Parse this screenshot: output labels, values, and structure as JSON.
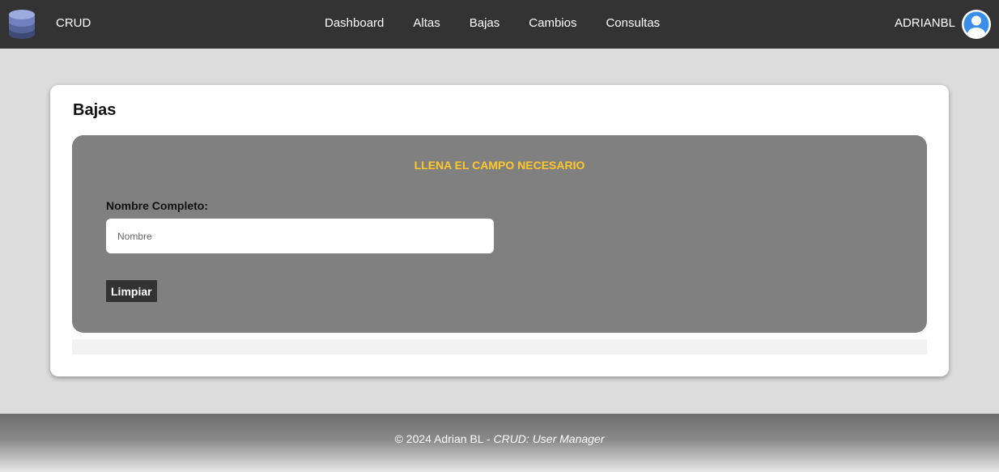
{
  "header": {
    "brand": "CRUD",
    "brand_icon": "database-icon",
    "nav": [
      {
        "label": "Dashboard"
      },
      {
        "label": "Altas"
      },
      {
        "label": "Bajas"
      },
      {
        "label": "Cambios"
      },
      {
        "label": "Consultas"
      }
    ],
    "username": "ADRIANBL",
    "avatar_icon": "user-avatar-icon"
  },
  "main": {
    "title": "Bajas",
    "notice": "LLENA EL CAMPO NECESARIO",
    "field_label": "Nombre Completo:",
    "name_input": {
      "placeholder": "Nombre",
      "value": ""
    },
    "clear_button": "Limpiar"
  },
  "footer": {
    "prefix": "© 2024 Adrian BL - ",
    "suffix": "CRUD: User Manager"
  },
  "colors": {
    "navbar": "#333333",
    "notice": "#ffc82a",
    "panel": "#808080",
    "avatar": "#3b8ee8"
  }
}
